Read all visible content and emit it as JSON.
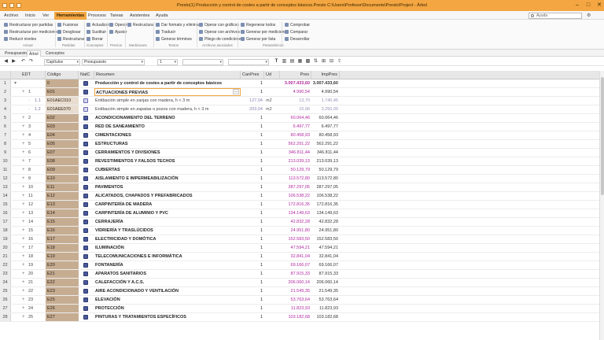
{
  "window": {
    "title": "Presto(1) Producción y control de costes a partir de conceptos básicos.Presto C:\\Users\\Profesor\\Documents\\Presto\\Project - Árbol"
  },
  "menu": {
    "tabs": [
      "Archivo",
      "Inicio",
      "Ver",
      "Herramientas",
      "Procesos",
      "Tareas",
      "Asistentes",
      "Ayuda"
    ],
    "active": "Herramientas",
    "search_placeholder": "Ayuda",
    "right": [
      "Informes",
      "Asistentes",
      "Obras",
      "Complementos"
    ]
  },
  "ribbon": {
    "groups": [
      {
        "label": "Actuar",
        "items": [
          "Restructurar por partidas",
          "Restructurar por mediciones",
          "Reducir niveles"
        ]
      },
      {
        "label": "Partidas",
        "items": [
          "Fusionar",
          "Desglosar",
          "Restructurar"
        ]
      },
      {
        "label": "Conceptos",
        "items": [
          "Actualizar",
          "Sustituir",
          "Borrar"
        ]
      },
      {
        "label": "Precios",
        "items": [
          "Operar",
          "Ajustar"
        ]
      },
      {
        "label": "Mediciones",
        "items": [
          "Restructurar"
        ]
      },
      {
        "label": "Textos",
        "items": [
          "Dar formato y eliminar",
          "Traducir",
          "Generar términos"
        ]
      },
      {
        "label": "Archivos asociados",
        "items": [
          "Operar con gráficos",
          "Operar con archivos",
          "Pliego de condiciones"
        ]
      },
      {
        "label": "Paramétricos",
        "items": [
          "Regenerar todos",
          "Generar por mediciones",
          "Generar por lista"
        ]
      },
      {
        "label": "",
        "items": [
          "Comprobar",
          "Comparar",
          "Desarrollar"
        ]
      }
    ]
  },
  "doctabs": {
    "items": [
      "Presupuesto",
      "Árbol",
      "Conceptos"
    ],
    "active": "Árbol"
  },
  "filters": {
    "scope": "Capítulos",
    "view": "Presupuesto",
    "level": "1"
  },
  "grid": {
    "columns": {
      "edt": "EDT",
      "codigo": "Código",
      "natc": "NatC",
      "resumen": "Resumen",
      "canpres": "CanPres",
      "ud": "Ud",
      "pres": "Pres",
      "imppres": "ImpPres"
    },
    "rows": [
      {
        "n": "1",
        "lvl": 0,
        "edt": "",
        "cod": "0",
        "nat": "root",
        "res": "Producción y control de costes a partir de conceptos básicos",
        "can": "1",
        "ud": "",
        "pres": "3.007.433,60",
        "imp": "3.007.433,60"
      },
      {
        "n": "2",
        "lvl": 1,
        "edt": "1",
        "cod": "E01",
        "nat": "ch",
        "res": "ACTUACIONES PREVIAS",
        "can": "1",
        "ud": "",
        "pres": "4.990,54",
        "imp": "4.990,54",
        "sel": true
      },
      {
        "n": "3",
        "lvl": 2,
        "edt": "1.1",
        "cod": "E01AEC010",
        "nat": "item",
        "res": "Entibación simple en zanjas con madera, h < 3 m",
        "can": "127,04",
        "ud": "m2",
        "pres": "13,70",
        "imp": "1.740,45"
      },
      {
        "n": "4",
        "lvl": 2,
        "edt": "1.2",
        "cod": "E01AEE070",
        "nat": "item",
        "res": "Entibación simple en zapatas o pozos con madera, h < 3 m",
        "can": "203,04",
        "ud": "m2",
        "pres": "15,96",
        "imp": "3.250,09"
      },
      {
        "n": "5",
        "lvl": 1,
        "edt": "2",
        "cod": "E02",
        "nat": "ch",
        "res": "ACONDICIONAMIENTO DEL TERRENO",
        "can": "1",
        "ud": "",
        "pres": "60.064,46",
        "imp": "60.064,46"
      },
      {
        "n": "6",
        "lvl": 1,
        "edt": "3",
        "cod": "E03",
        "nat": "ch",
        "res": "RED DE SANEAMIENTO",
        "can": "1",
        "ud": "",
        "pres": "6.497,77",
        "imp": "6.497,77"
      },
      {
        "n": "7",
        "lvl": 1,
        "edt": "4",
        "cod": "E04",
        "nat": "ch",
        "res": "CIMENTACIONES",
        "can": "1",
        "ud": "",
        "pres": "80.458,93",
        "imp": "80.458,93"
      },
      {
        "n": "8",
        "lvl": 1,
        "edt": "5",
        "cod": "E05",
        "nat": "ch",
        "res": "ESTRUCTURAS",
        "can": "1",
        "ud": "",
        "pres": "562.291,22",
        "imp": "562.291,22"
      },
      {
        "n": "9",
        "lvl": 1,
        "edt": "6",
        "cod": "E07",
        "nat": "ch",
        "res": "CERRAMIENTOS Y DIVISIONES",
        "can": "1",
        "ud": "",
        "pres": "346.811,44",
        "imp": "346.811,44"
      },
      {
        "n": "10",
        "lvl": 1,
        "edt": "7",
        "cod": "E08",
        "nat": "ch",
        "res": "REVESTIMIENTOS Y FALSOS TECHOS",
        "can": "1",
        "ud": "",
        "pres": "213.039,13",
        "imp": "213.039,13"
      },
      {
        "n": "11",
        "lvl": 1,
        "edt": "8",
        "cod": "E09",
        "nat": "ch",
        "res": "CUBIERTAS",
        "can": "1",
        "ud": "",
        "pres": "50.129,79",
        "imp": "50.129,79"
      },
      {
        "n": "12",
        "lvl": 1,
        "edt": "9",
        "cod": "E10",
        "nat": "ch",
        "res": "AISLAMIENTO E IMPERMEABILIZACIÓN",
        "can": "1",
        "ud": "",
        "pres": "113.572,80",
        "imp": "113.572,80"
      },
      {
        "n": "13",
        "lvl": 1,
        "edt": "10",
        "cod": "E11",
        "nat": "ch",
        "res": "PAVIMENTOS",
        "can": "1",
        "ud": "",
        "pres": "287.297,05",
        "imp": "287.297,05"
      },
      {
        "n": "14",
        "lvl": 1,
        "edt": "11",
        "cod": "E12",
        "nat": "ch",
        "res": "ALICATADOS, CHAPADOS Y PREFABRICADOS",
        "can": "1",
        "ud": "",
        "pres": "106.538,22",
        "imp": "106.538,22"
      },
      {
        "n": "15",
        "lvl": 1,
        "edt": "12",
        "cod": "E13",
        "nat": "ch",
        "res": "CARPINTERÍA DE MADERA",
        "can": "1",
        "ud": "",
        "pres": "172.816,35",
        "imp": "172.816,35"
      },
      {
        "n": "16",
        "lvl": 1,
        "edt": "13",
        "cod": "E14",
        "nat": "ch",
        "res": "CARPINTERÍA DE ALUMINIO Y PVC",
        "can": "1",
        "ud": "",
        "pres": "134.149,63",
        "imp": "134.149,63"
      },
      {
        "n": "17",
        "lvl": 1,
        "edt": "14",
        "cod": "E15",
        "nat": "ch",
        "res": "CERRAJERÍA",
        "can": "1",
        "ud": "",
        "pres": "42.832,28",
        "imp": "42.832,28"
      },
      {
        "n": "18",
        "lvl": 1,
        "edt": "15",
        "cod": "E16",
        "nat": "ch",
        "res": "VIDRIERÍA Y TRASLÚCIDOS",
        "can": "1",
        "ud": "",
        "pres": "24.951,80",
        "imp": "24.951,80"
      },
      {
        "n": "19",
        "lvl": 1,
        "edt": "16",
        "cod": "E17",
        "nat": "ch",
        "res": "ELECTRICIDAD Y DOMÓTICA",
        "can": "1",
        "ud": "",
        "pres": "152.583,50",
        "imp": "152.583,50"
      },
      {
        "n": "20",
        "lvl": 1,
        "edt": "17",
        "cod": "E18",
        "nat": "ch",
        "res": "ILUMINACIÓN",
        "can": "1",
        "ud": "",
        "pres": "47.594,21",
        "imp": "47.594,21"
      },
      {
        "n": "21",
        "lvl": 1,
        "edt": "18",
        "cod": "E19",
        "nat": "ch",
        "res": "TELECOMUNICACIONES E INFORMÁTICA",
        "can": "1",
        "ud": "",
        "pres": "32.841,04",
        "imp": "32.841,04"
      },
      {
        "n": "22",
        "lvl": 1,
        "edt": "19",
        "cod": "E20",
        "nat": "ch",
        "res": "FONTANERÍA",
        "can": "1",
        "ud": "",
        "pres": "69.166,07",
        "imp": "69.166,07"
      },
      {
        "n": "23",
        "lvl": 1,
        "edt": "20",
        "cod": "E21",
        "nat": "ch",
        "res": "APARATOS SANITARIOS",
        "can": "1",
        "ud": "",
        "pres": "87.915,33",
        "imp": "87.915,33"
      },
      {
        "n": "24",
        "lvl": 1,
        "edt": "21",
        "cod": "E22",
        "nat": "ch",
        "res": "CALEFACCIÓN Y A.C.S.",
        "can": "1",
        "ud": "",
        "pres": "206.060,14",
        "imp": "206.060,14"
      },
      {
        "n": "25",
        "lvl": 1,
        "edt": "22",
        "cod": "E23",
        "nat": "ch",
        "res": "AIRE ACONDICIONADO Y VENTILACIÓN",
        "can": "1",
        "ud": "",
        "pres": "21.549,35",
        "imp": "21.549,35"
      },
      {
        "n": "26",
        "lvl": 1,
        "edt": "23",
        "cod": "E25",
        "nat": "ch",
        "res": "ELEVACIÓN",
        "can": "1",
        "ud": "",
        "pres": "53.763,64",
        "imp": "53.763,64"
      },
      {
        "n": "27",
        "lvl": 1,
        "edt": "24",
        "cod": "E26",
        "nat": "ch",
        "res": "PROTECCIÓN",
        "can": "1",
        "ud": "",
        "pres": "11.823,93",
        "imp": "11.823,93"
      },
      {
        "n": "28",
        "lvl": 1,
        "edt": "25",
        "cod": "E27",
        "nat": "ch",
        "res": "PINTURAS Y TRATAMIENTOS ESPECÍFICOS",
        "can": "1",
        "ud": "",
        "pres": "103.182,68",
        "imp": "103.182,68"
      }
    ]
  }
}
